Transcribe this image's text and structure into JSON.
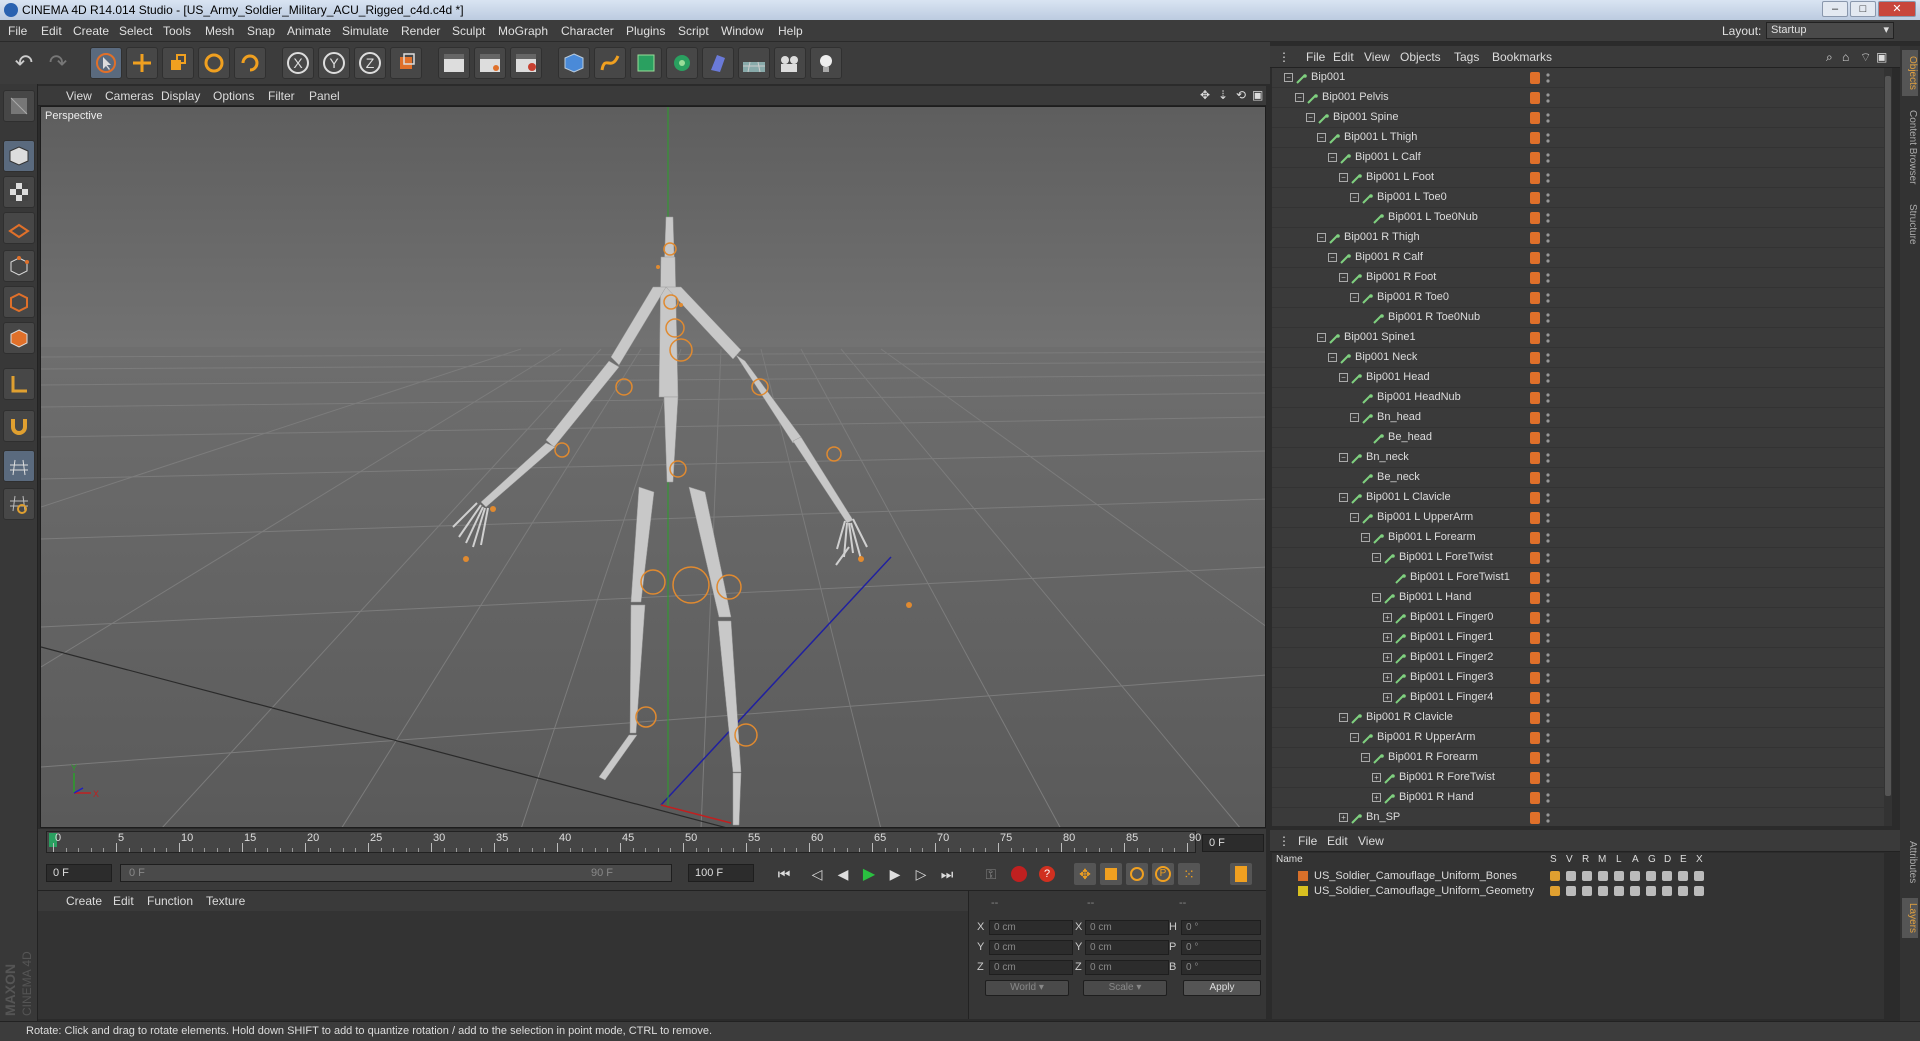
{
  "window": {
    "title": "CINEMA 4D R14.014 Studio - [US_Army_Soldier_Military_ACU_Rigged_c4d.c4d *]"
  },
  "menubar": {
    "items": [
      "File",
      "Edit",
      "Create",
      "Select",
      "Tools",
      "Mesh",
      "Snap",
      "Animate",
      "Simulate",
      "Render",
      "Sculpt",
      "MoGraph",
      "Character",
      "Plugins",
      "Script",
      "Window",
      "Help"
    ],
    "layout_label": "Layout:",
    "layout_value": "Startup"
  },
  "viewport": {
    "menu": [
      "View",
      "Cameras",
      "Display",
      "Options",
      "Filter",
      "Panel"
    ],
    "label": "Perspective"
  },
  "timeline": {
    "ticks": [
      "0",
      "5",
      "10",
      "15",
      "20",
      "25",
      "30",
      "35",
      "40",
      "45",
      "50",
      "55",
      "60",
      "65",
      "70",
      "75",
      "80",
      "85",
      "90"
    ],
    "current_frame": "0 F"
  },
  "transport": {
    "start_field": "0 F",
    "range_start": "0 F",
    "range_end": "90 F",
    "end_field": "100 F"
  },
  "materials": {
    "menu": [
      "Create",
      "Edit",
      "Function",
      "Texture"
    ]
  },
  "coords": {
    "headers": [
      "--",
      "--",
      "--"
    ],
    "rows": [
      {
        "a": "X",
        "va": "0 cm",
        "b": "X",
        "vb": "0 cm",
        "c": "H",
        "vc": "0 °"
      },
      {
        "a": "Y",
        "va": "0 cm",
        "b": "Y",
        "vb": "0 cm",
        "c": "P",
        "vc": "0 °"
      },
      {
        "a": "Z",
        "va": "0 cm",
        "b": "Z",
        "vb": "0 cm",
        "c": "B",
        "vc": "0 °"
      }
    ],
    "world": "World",
    "scale": "Scale",
    "apply": "Apply"
  },
  "object_manager": {
    "menu": [
      "File",
      "Edit",
      "View",
      "Objects",
      "Tags",
      "Bookmarks"
    ],
    "objects": [
      {
        "name": "Bip001",
        "depth": 0,
        "exp": "-"
      },
      {
        "name": "Bip001 Pelvis",
        "depth": 1,
        "exp": "-"
      },
      {
        "name": "Bip001 Spine",
        "depth": 2,
        "exp": "-"
      },
      {
        "name": "Bip001 L Thigh",
        "depth": 3,
        "exp": "-"
      },
      {
        "name": "Bip001 L Calf",
        "depth": 4,
        "exp": "-"
      },
      {
        "name": "Bip001 L Foot",
        "depth": 5,
        "exp": "-"
      },
      {
        "name": "Bip001 L Toe0",
        "depth": 6,
        "exp": "-"
      },
      {
        "name": "Bip001 L Toe0Nub",
        "depth": 7,
        "exp": ""
      },
      {
        "name": "Bip001 R Thigh",
        "depth": 3,
        "exp": "-"
      },
      {
        "name": "Bip001 R Calf",
        "depth": 4,
        "exp": "-"
      },
      {
        "name": "Bip001 R Foot",
        "depth": 5,
        "exp": "-"
      },
      {
        "name": "Bip001 R Toe0",
        "depth": 6,
        "exp": "-"
      },
      {
        "name": "Bip001 R Toe0Nub",
        "depth": 7,
        "exp": ""
      },
      {
        "name": "Bip001 Spine1",
        "depth": 3,
        "exp": "-"
      },
      {
        "name": "Bip001 Neck",
        "depth": 4,
        "exp": "-"
      },
      {
        "name": "Bip001 Head",
        "depth": 5,
        "exp": "-"
      },
      {
        "name": "Bip001 HeadNub",
        "depth": 6,
        "exp": ""
      },
      {
        "name": "Bn_head",
        "depth": 6,
        "exp": "-"
      },
      {
        "name": "Be_head",
        "depth": 7,
        "exp": ""
      },
      {
        "name": "Bn_neck",
        "depth": 5,
        "exp": "-"
      },
      {
        "name": "Be_neck",
        "depth": 6,
        "exp": ""
      },
      {
        "name": "Bip001 L Clavicle",
        "depth": 5,
        "exp": "-"
      },
      {
        "name": "Bip001 L UpperArm",
        "depth": 6,
        "exp": "-"
      },
      {
        "name": "Bip001 L Forearm",
        "depth": 7,
        "exp": "-"
      },
      {
        "name": "Bip001 L ForeTwist",
        "depth": 8,
        "exp": "-"
      },
      {
        "name": "Bip001 L ForeTwist1",
        "depth": 9,
        "exp": ""
      },
      {
        "name": "Bip001 L Hand",
        "depth": 8,
        "exp": "-"
      },
      {
        "name": "Bip001 L Finger0",
        "depth": 9,
        "exp": "+"
      },
      {
        "name": "Bip001 L Finger1",
        "depth": 9,
        "exp": "+"
      },
      {
        "name": "Bip001 L Finger2",
        "depth": 9,
        "exp": "+"
      },
      {
        "name": "Bip001 L Finger3",
        "depth": 9,
        "exp": "+"
      },
      {
        "name": "Bip001 L Finger4",
        "depth": 9,
        "exp": "+"
      },
      {
        "name": "Bip001 R Clavicle",
        "depth": 5,
        "exp": "-"
      },
      {
        "name": "Bip001 R UpperArm",
        "depth": 6,
        "exp": "-"
      },
      {
        "name": "Bip001 R Forearm",
        "depth": 7,
        "exp": "-"
      },
      {
        "name": "Bip001 R ForeTwist",
        "depth": 8,
        "exp": "+"
      },
      {
        "name": "Bip001 R Hand",
        "depth": 8,
        "exp": "+"
      },
      {
        "name": "Bn_SP",
        "depth": 5,
        "exp": "+"
      }
    ]
  },
  "layer_manager": {
    "menu": [
      "File",
      "Edit",
      "View"
    ],
    "headers": [
      "Name",
      "S",
      "V",
      "R",
      "M",
      "L",
      "A",
      "G",
      "D",
      "E",
      "X"
    ],
    "layers": [
      {
        "name": "US_Soldier_Camouflage_Uniform_Bones",
        "color": "#d8702a"
      },
      {
        "name": "US_Soldier_Camouflage_Uniform_Geometry",
        "color": "#d8c020"
      }
    ]
  },
  "side_tabs": [
    "Objects",
    "Content Browser",
    "Structure",
    "Attributes",
    "Layers"
  ],
  "status": "Rotate: Click and drag to rotate elements. Hold down SHIFT to add to quantize rotation / add to the selection in point mode, CTRL to remove.",
  "logo": {
    "line1": "MAXON",
    "line2": "CINEMA 4D"
  },
  "colors": {
    "accent": "#e0702a",
    "panel": "#3a3a3a",
    "viewport": "#6a6a6a"
  }
}
